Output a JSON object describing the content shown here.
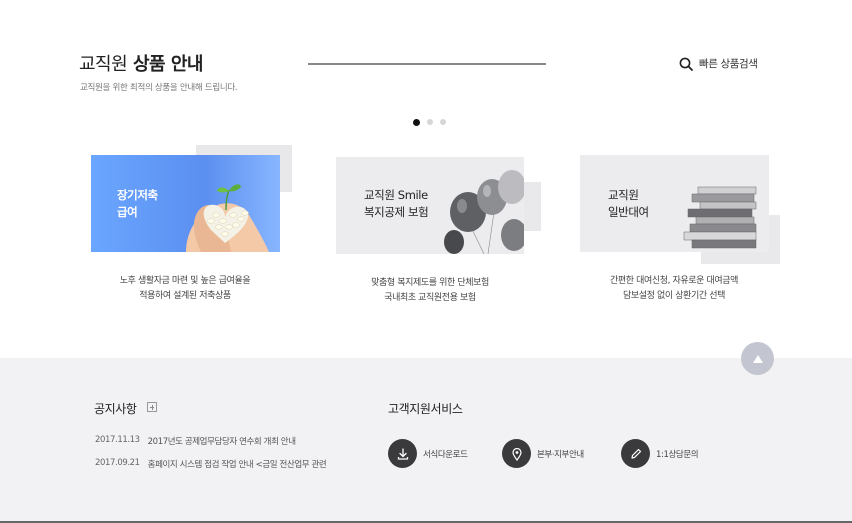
{
  "header": {
    "title_light": "교직원",
    "title_bold": "상품 안내",
    "subtitle": "교직원을 위한 최적의 상품을 안내해 드립니다.",
    "quick_search_label": "빠른 상품검색"
  },
  "carousel": {
    "total_pages": 3,
    "active_page": 1
  },
  "products": [
    {
      "name_line1": "장기저축",
      "name_line2": "급여",
      "desc_line1": "노후 생활자금 마련 및 높은 급여율을",
      "desc_line2": "적용하여 설계된 저축상품",
      "image": "heart-beans-image"
    },
    {
      "name_line1": "교직원 Smile",
      "name_line2": "복지공제 보험",
      "desc_line1": "맞춤형 복지제도를 위한 단체보험",
      "desc_line2": "국내최초 교직원전용 보험",
      "image": "balloons-image"
    },
    {
      "name_line1": "교직원",
      "name_line2": "일반대여",
      "desc_line1": "간편한 대여신청, 자유로운 대여금액",
      "desc_line2": "담보설정 없이 상환기간 선택",
      "image": "book-stack-image"
    }
  ],
  "footer": {
    "notice_title": "공지사항",
    "notices": [
      {
        "date": "2017.11.13",
        "title": "2017년도 공제업무담당자 연수회 개최 안내"
      },
      {
        "date": "2017.09.21",
        "title": "홈페이지 시스템 점검 작업 안내 <금일 전산업무 관련"
      }
    ],
    "cs_title": "고객지원서비스",
    "cs_items": [
      {
        "label": "서식다운로드",
        "icon": "download-icon"
      },
      {
        "label": "본부·지부안내",
        "icon": "location-pin-icon"
      },
      {
        "label": "1:1상담문의",
        "icon": "pencil-icon"
      }
    ]
  },
  "colors": {
    "accent_blue": "#5b8ff0",
    "dark": "#3a3a3d",
    "footer_bg": "#f2f2f4",
    "top_button": "#c3c5d0"
  }
}
